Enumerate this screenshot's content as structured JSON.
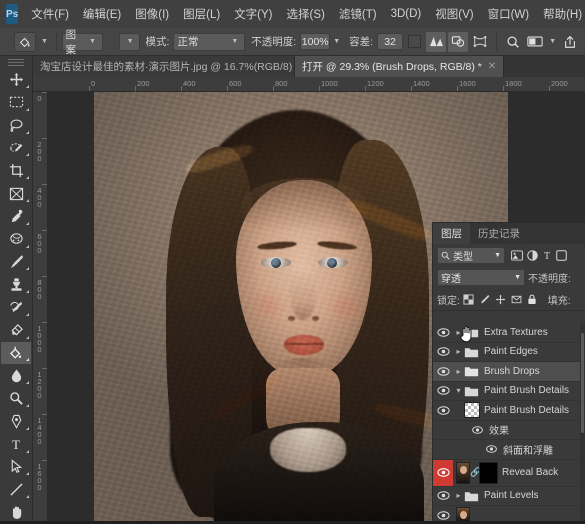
{
  "app": {
    "name": "Adobe Photoshop",
    "logo_text": "Ps",
    "accent": "#1d5b80"
  },
  "menubar": {
    "items": [
      {
        "label": "文件(F)",
        "name": "menu-file"
      },
      {
        "label": "编辑(E)",
        "name": "menu-edit"
      },
      {
        "label": "图像(I)",
        "name": "menu-image"
      },
      {
        "label": "图层(L)",
        "name": "menu-layer"
      },
      {
        "label": "文字(Y)",
        "name": "menu-type"
      },
      {
        "label": "选择(S)",
        "name": "menu-select"
      },
      {
        "label": "滤镜(T)",
        "name": "menu-filter"
      },
      {
        "label": "3D(D)",
        "name": "menu-3d"
      },
      {
        "label": "视图(V)",
        "name": "menu-view"
      },
      {
        "label": "窗口(W)",
        "name": "menu-window"
      },
      {
        "label": "帮助(H)",
        "name": "menu-help"
      }
    ],
    "window_controls": {
      "minimize": "—",
      "maximize": "□",
      "close": "✕"
    }
  },
  "options_bar": {
    "tool_icon": "paint-bucket-icon",
    "fill_source": "图案",
    "mode_label": "模式:",
    "mode_value": "正常",
    "opacity_label": "不透明度:",
    "opacity_value": "100%",
    "tolerance_label": "容差:",
    "tolerance_value": "32",
    "right_icons": [
      "gradient-icon",
      "shape-merge-icon",
      "warp-transform-icon",
      "search-icon",
      "workspace-icon",
      "share-icon"
    ]
  },
  "document_tabs": [
    {
      "label": "淘宝店设计最佳的素材·演示图片.jpg @ 16.7%(RGB/8)",
      "active": false,
      "close": "✕"
    },
    {
      "label": "打开 @ 29.3% (Brush Drops, RGB/8) *",
      "active": true,
      "close": "✕"
    }
  ],
  "toolbar": {
    "tools": [
      {
        "name": "move-tool",
        "glyph": "move",
        "active": false
      },
      {
        "name": "marquee-tool",
        "glyph": "marquee",
        "active": false
      },
      {
        "name": "lasso-tool",
        "glyph": "lasso",
        "active": false
      },
      {
        "name": "quick-selection-tool",
        "glyph": "quickselect",
        "active": false
      },
      {
        "name": "crop-tool",
        "glyph": "crop",
        "active": false
      },
      {
        "name": "frame-tool",
        "glyph": "frame",
        "active": false
      },
      {
        "name": "eyedropper-tool",
        "glyph": "eyedropper",
        "active": false
      },
      {
        "name": "healing-brush-tool",
        "glyph": "healing",
        "active": false
      },
      {
        "name": "brush-tool",
        "glyph": "brush",
        "active": false
      },
      {
        "name": "clone-stamp-tool",
        "glyph": "stamp",
        "active": false
      },
      {
        "name": "history-brush-tool",
        "glyph": "historybrush",
        "active": false
      },
      {
        "name": "eraser-tool",
        "glyph": "eraser",
        "active": false
      },
      {
        "name": "paint-bucket-tool",
        "glyph": "bucket",
        "active": true
      },
      {
        "name": "blur-tool",
        "glyph": "blur",
        "active": false
      },
      {
        "name": "dodge-tool",
        "glyph": "dodge",
        "active": false
      },
      {
        "name": "pen-tool",
        "glyph": "pen",
        "active": false
      },
      {
        "name": "type-tool",
        "glyph": "type",
        "active": false
      },
      {
        "name": "path-selection-tool",
        "glyph": "pathselect",
        "active": false
      },
      {
        "name": "line-tool",
        "glyph": "line",
        "active": false
      },
      {
        "name": "hand-tool",
        "glyph": "hand",
        "active": false
      }
    ]
  },
  "canvas": {
    "zoom": "29.3%",
    "color_mode": "RGB/8",
    "ruler_h_ticks": [
      "0",
      "200",
      "400",
      "600",
      "800",
      "1000",
      "1200",
      "1400",
      "1600",
      "1800",
      "2000"
    ],
    "ruler_v_ticks": [
      "0",
      "200",
      "400",
      "600",
      "800",
      "1000",
      "1200",
      "1400",
      "1600"
    ]
  },
  "layers_panel": {
    "tabs": [
      {
        "label": "图层",
        "active": true,
        "name": "tab-layers"
      },
      {
        "label": "历史记录",
        "active": false,
        "name": "tab-history"
      }
    ],
    "filter": {
      "search_icon": "search-icon",
      "type_label": "类型",
      "chevron": "⌄",
      "icons": [
        "pixel-filter-icon",
        "adjustment-filter-icon",
        "type-filter-icon",
        "shape-filter-icon",
        "smart-filter-icon"
      ]
    },
    "blend": {
      "mode": "穿透",
      "chevron": "⌄",
      "opacity_label": "不透明度:"
    },
    "lock": {
      "label": "锁定:",
      "icons": [
        "lock-transparency-icon",
        "lock-image-icon",
        "lock-position-icon",
        "lock-artboard-icon",
        "lock-all-icon"
      ],
      "fill_label": "填充:"
    },
    "layers": [
      {
        "name": "Extra Textures",
        "kind": "group",
        "visible": true,
        "expanded": false,
        "indent": 0,
        "selected": false,
        "thumb": "folder"
      },
      {
        "name": "Paint Edges",
        "kind": "group",
        "visible": true,
        "expanded": false,
        "indent": 0,
        "selected": false,
        "thumb": "folder"
      },
      {
        "name": "Brush Drops",
        "kind": "group",
        "visible": true,
        "expanded": false,
        "indent": 0,
        "selected": true,
        "thumb": "folder"
      },
      {
        "name": "Paint Brush Details",
        "kind": "group",
        "visible": true,
        "expanded": true,
        "indent": 0,
        "selected": false,
        "thumb": "folder"
      },
      {
        "name": "Paint Brush Details",
        "kind": "layer",
        "visible": true,
        "expanded": false,
        "indent": 1,
        "selected": false,
        "thumb": "checker"
      },
      {
        "name": "效果",
        "kind": "effects",
        "visible": true,
        "expanded": true,
        "indent": 2,
        "selected": false,
        "thumb": "none"
      },
      {
        "name": "斜面和浮雕",
        "kind": "effect",
        "visible": true,
        "expanded": false,
        "indent": 3,
        "selected": false,
        "thumb": "none"
      },
      {
        "name": "Reveal Back",
        "kind": "layer-mask",
        "visible": true,
        "expanded": false,
        "indent": 0,
        "selected": false,
        "thumb": "portrait-mask",
        "eye_highlight": "#cf3b32"
      },
      {
        "name": "Paint Levels",
        "kind": "group",
        "visible": true,
        "expanded": false,
        "indent": 0,
        "selected": false,
        "thumb": "folder"
      }
    ],
    "cursor": "hand-cursor"
  }
}
